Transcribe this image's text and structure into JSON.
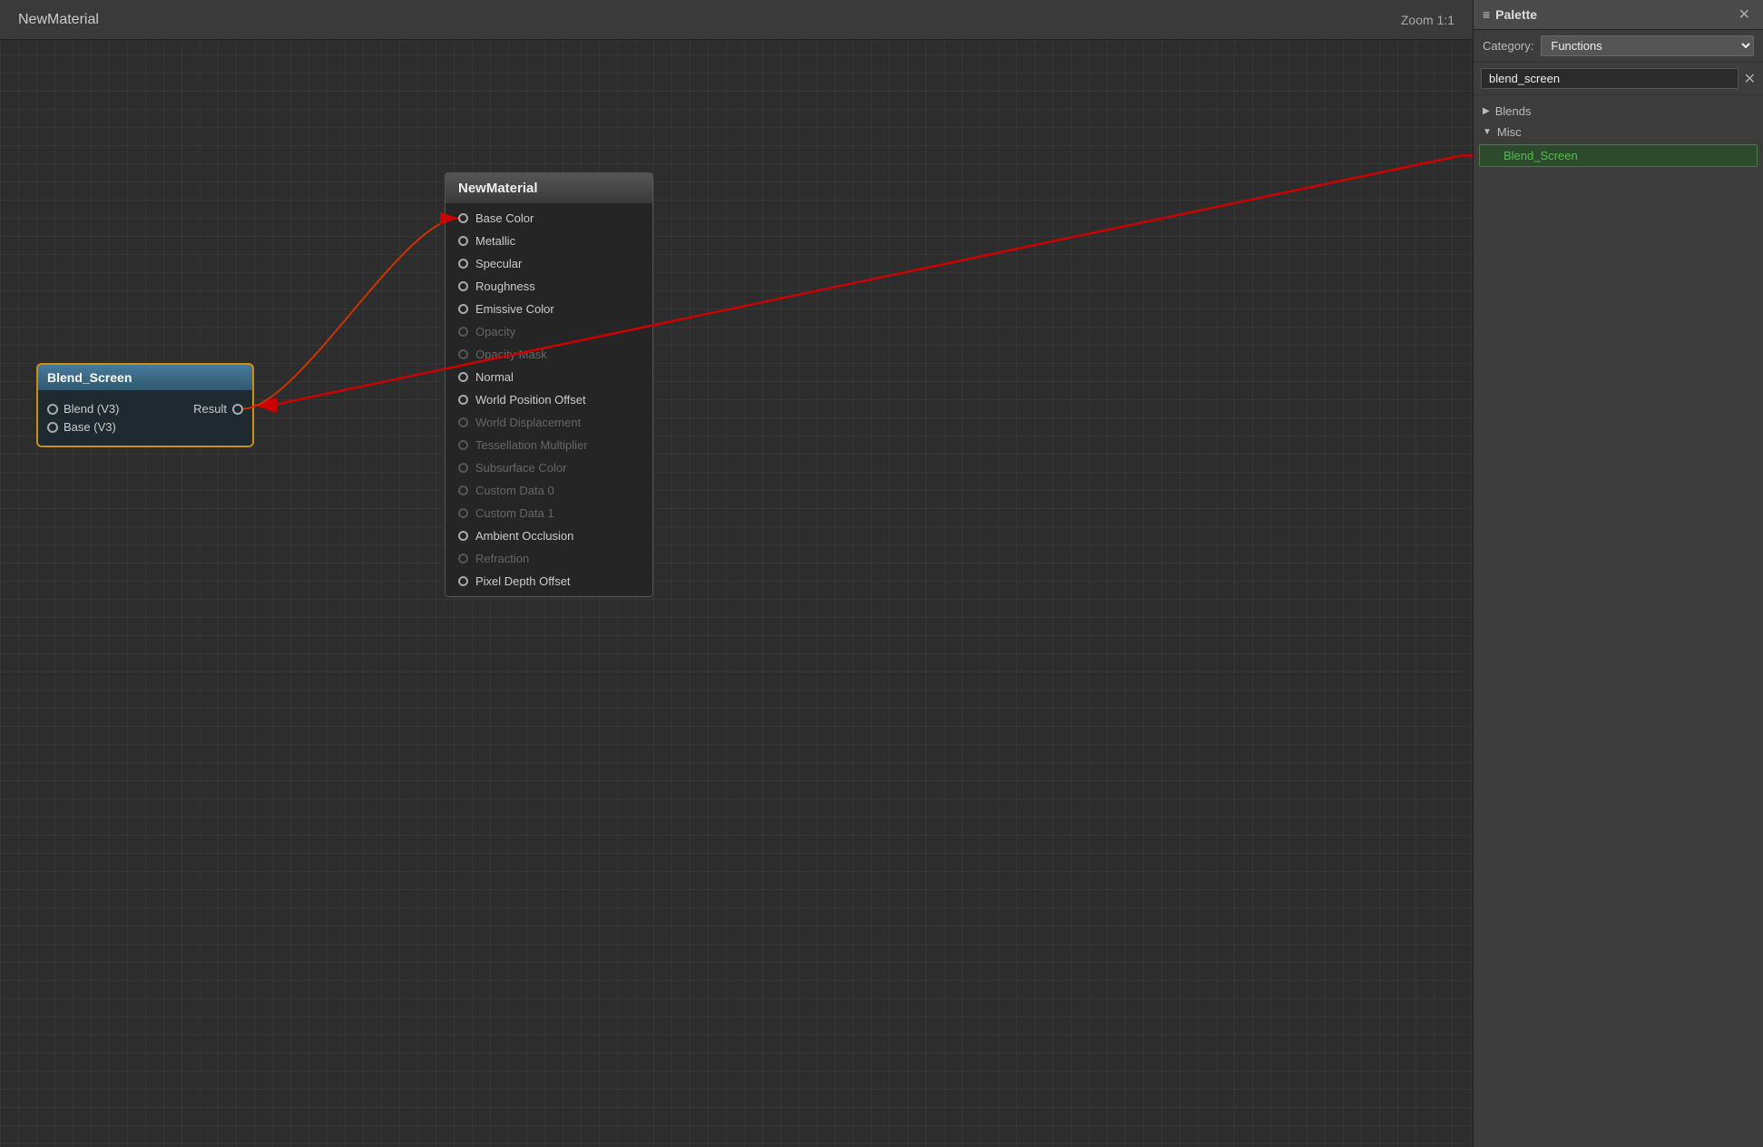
{
  "canvas": {
    "title": "NewMaterial",
    "zoom_label": "Zoom 1:1"
  },
  "blend_screen_node": {
    "title": "Blend_Screen",
    "pins": [
      {
        "label": "Blend (V3)",
        "has_right_pin": true,
        "right_label": "Result"
      },
      {
        "label": "Base (V3)",
        "has_right_pin": false
      }
    ]
  },
  "material_node": {
    "title": "NewMaterial",
    "pins": [
      {
        "label": "Base Color",
        "enabled": true
      },
      {
        "label": "Metallic",
        "enabled": true
      },
      {
        "label": "Specular",
        "enabled": true
      },
      {
        "label": "Roughness",
        "enabled": true
      },
      {
        "label": "Emissive Color",
        "enabled": true
      },
      {
        "label": "Opacity",
        "enabled": false
      },
      {
        "label": "Opacity Mask",
        "enabled": false
      },
      {
        "label": "Normal",
        "enabled": true
      },
      {
        "label": "World Position Offset",
        "enabled": true
      },
      {
        "label": "World Displacement",
        "enabled": false
      },
      {
        "label": "Tessellation Multiplier",
        "enabled": false
      },
      {
        "label": "Subsurface Color",
        "enabled": false
      },
      {
        "label": "Custom Data 0",
        "enabled": false
      },
      {
        "label": "Custom Data 1",
        "enabled": false
      },
      {
        "label": "Ambient Occlusion",
        "enabled": true
      },
      {
        "label": "Refraction",
        "enabled": false
      },
      {
        "label": "Pixel Depth Offset",
        "enabled": true
      }
    ]
  },
  "palette": {
    "title": "Palette",
    "title_icon": "≡",
    "close_btn": "✕",
    "category_label": "Category:",
    "category_value": "Functions",
    "search_placeholder": "blend_screen",
    "search_value": "blend_screen",
    "groups": [
      {
        "label": "Blends",
        "expanded": false,
        "arrow": "▶"
      },
      {
        "label": "Misc",
        "expanded": true,
        "arrow": "▼"
      }
    ],
    "items": [
      {
        "label": "Blend_Screen"
      }
    ]
  },
  "connector": {
    "color": "#cc0000",
    "stroke_width": 2
  }
}
